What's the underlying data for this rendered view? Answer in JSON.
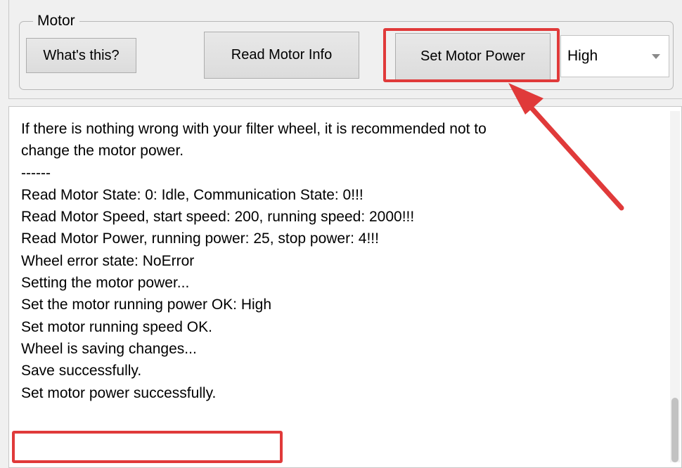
{
  "motor_group": {
    "legend": "Motor",
    "whats_this_label": "What's this?",
    "read_motor_info_label": "Read Motor Info",
    "set_motor_power_label": "Set Motor Power",
    "power_select": {
      "value": "High"
    }
  },
  "log": [
    "If there is nothing wrong with your filter wheel, it is recommended not to",
    "change the motor power.",
    "------",
    "Read Motor State: 0: Idle, Communication State: 0!!!",
    "Read Motor Speed, start speed: 200, running speed: 2000!!!",
    "Read Motor Power, running power: 25, stop power: 4!!!",
    "Wheel error state: NoError",
    "Setting the motor power...",
    "Set the motor running power OK: High",
    "Set motor running speed OK.",
    "Wheel is saving changes...",
    "Save successfully.",
    "Set motor power successfully."
  ],
  "annotation": {
    "color": "#e03a3a"
  }
}
